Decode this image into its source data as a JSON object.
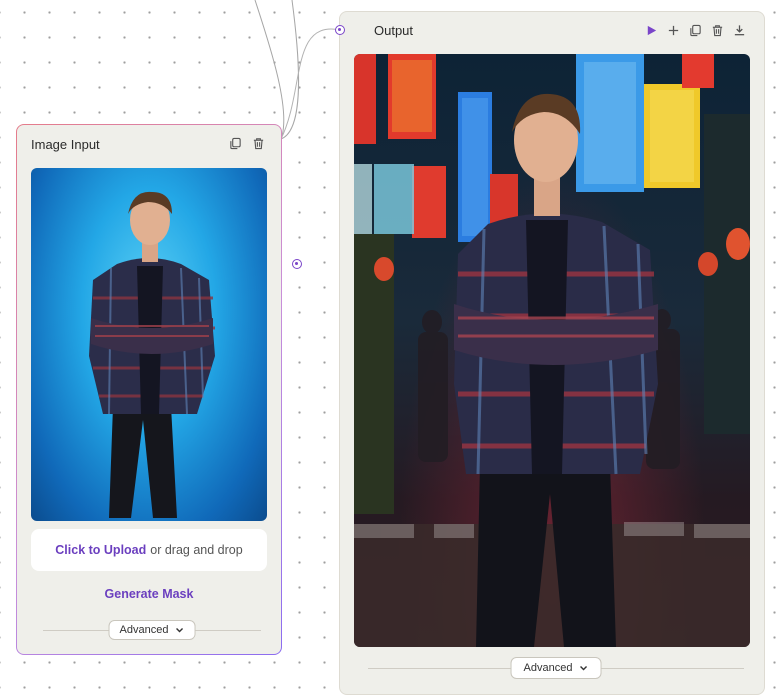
{
  "canvas": {
    "accent_color": "#7a45c9",
    "node_background": "#efefea"
  },
  "image_input_node": {
    "title": "Image Input",
    "icons": [
      "copy-icon",
      "trash-icon"
    ],
    "upload": {
      "link_text": "Click to Upload",
      "rest_text": "or drag and drop"
    },
    "generate_mask_label": "Generate Mask",
    "advanced_label": "Advanced"
  },
  "output_node": {
    "title": "Output",
    "icons": [
      "play-icon",
      "plus-icon",
      "copy-icon",
      "trash-icon",
      "download-icon"
    ],
    "advanced_label": "Advanced"
  }
}
